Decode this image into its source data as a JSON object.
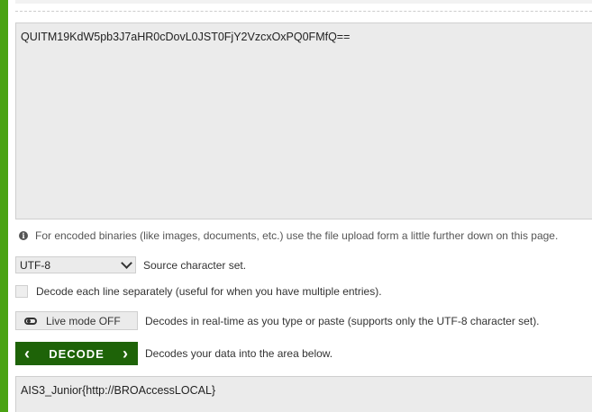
{
  "input": {
    "value": "QUITM19KdW5pb3J7aHR0cDovL0JST0FjY2VzcxOxPQ0FMfQ=="
  },
  "note": {
    "text": "For encoded binaries (like images, documents, etc.) use the file upload form a little further down on this page."
  },
  "charset": {
    "selected": "UTF-8",
    "label": "Source character set."
  },
  "each_line": {
    "label": "Decode each line separately (useful for when you have multiple entries)."
  },
  "live_mode": {
    "button_label": "Live mode OFF",
    "description": "Decodes in real-time as you type or paste (supports only the UTF-8 character set)."
  },
  "decode": {
    "button_label": "DECODE",
    "description": "Decodes your data into the area below."
  },
  "output": {
    "value": "AIS3_Junior{http://BROAccessLOCAL}"
  },
  "colors": {
    "accent_green": "#4aa313",
    "decode_button": "#1e6308",
    "field_bg": "#ebebeb"
  }
}
